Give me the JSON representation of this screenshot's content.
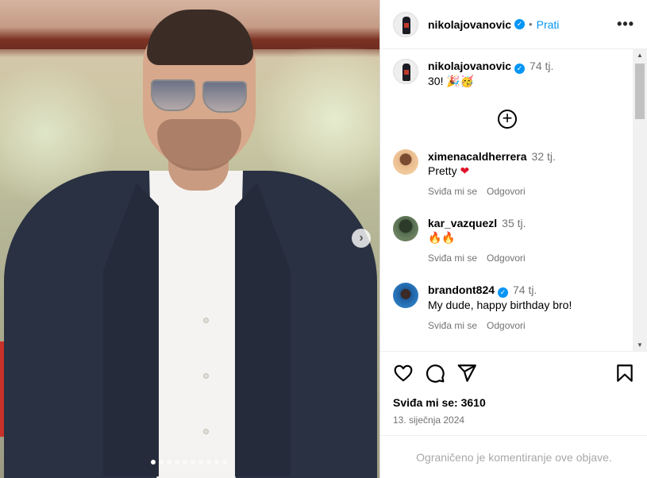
{
  "post": {
    "author": "nikolajovanovic",
    "follow_label": "Prati",
    "more_label": "•••",
    "separator": "•",
    "caption_author": "nikolajovanovic",
    "caption_time": "74 tj.",
    "caption_text": "30! 🎉🥳",
    "load_more": "+",
    "carousel_next": "›",
    "slide_count": 10,
    "active_slide": 1
  },
  "comments": [
    {
      "user": "ximenacaldherrera",
      "time": "32 tj.",
      "text": "Pretty",
      "emoji": "❤",
      "like": "Sviđa mi se",
      "reply": "Odgovori",
      "verified": false
    },
    {
      "user": "kar_vazquezl",
      "time": "35 tj.",
      "text": "🔥🔥",
      "like": "Sviđa mi se",
      "reply": "Odgovori",
      "verified": false
    },
    {
      "user": "brandont824",
      "time": "74 tj.",
      "text": "My dude, happy birthday bro!",
      "like": "Sviđa mi se",
      "reply": "Odgovori",
      "verified": true
    }
  ],
  "footer": {
    "likes_label": "Sviđa mi se: 3610",
    "date": "13. siječnja 2024",
    "restricted_text": "Ograničeno je komentiranje ove objave."
  },
  "colors": {
    "accent": "#0095f6",
    "muted": "#737373",
    "heart": "#e0142b"
  }
}
